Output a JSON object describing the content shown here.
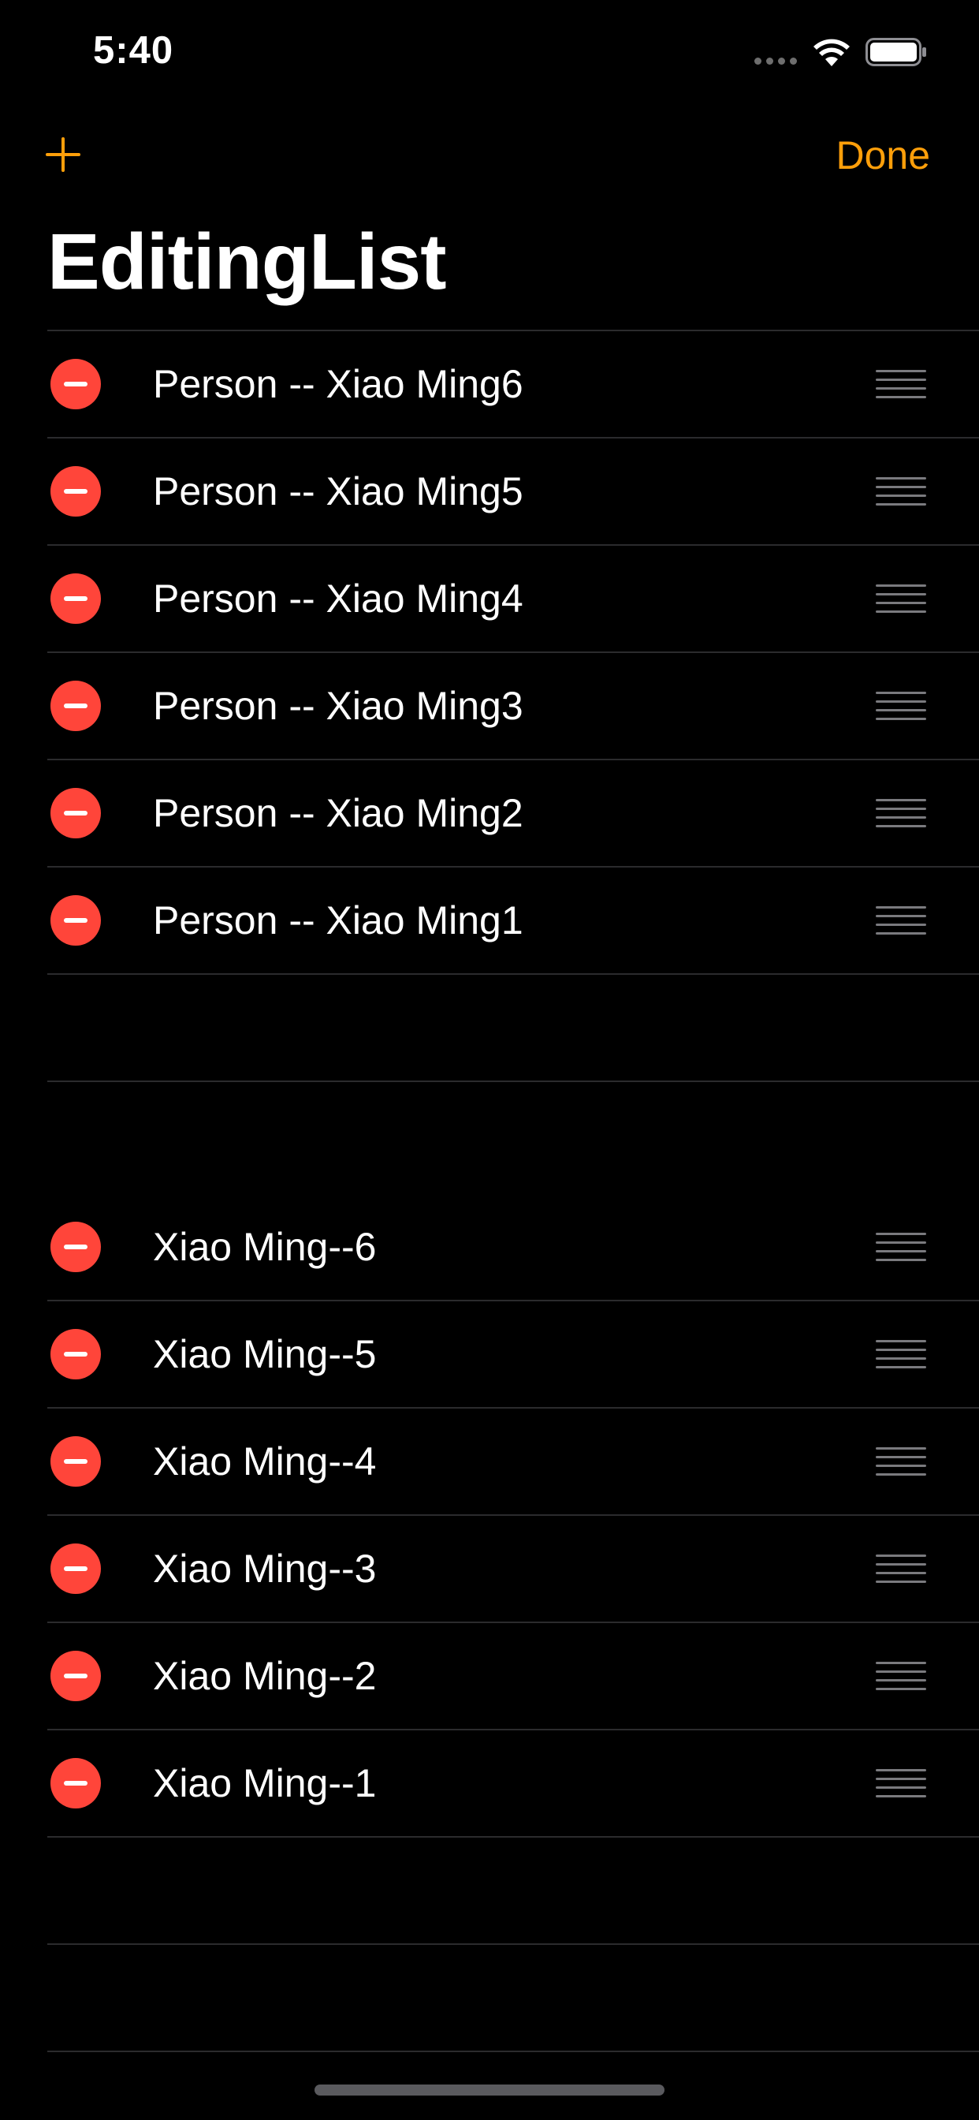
{
  "status_bar": {
    "time": "5:40"
  },
  "nav": {
    "add_icon": "plus-icon",
    "done_label": "Done"
  },
  "title": "EditingList",
  "section_1": {
    "rows": [
      {
        "label": "Person -- Xiao Ming6"
      },
      {
        "label": "Person -- Xiao Ming5"
      },
      {
        "label": "Person -- Xiao Ming4"
      },
      {
        "label": "Person -- Xiao Ming3"
      },
      {
        "label": "Person -- Xiao Ming2"
      },
      {
        "label": "Person -- Xiao Ming1"
      }
    ]
  },
  "section_2": {
    "rows": [
      {
        "label": "Xiao Ming--6"
      },
      {
        "label": "Xiao Ming--5"
      },
      {
        "label": "Xiao Ming--4"
      },
      {
        "label": "Xiao Ming--3"
      },
      {
        "label": "Xiao Ming--2"
      },
      {
        "label": "Xiao Ming--1"
      }
    ]
  },
  "colors": {
    "accent": "#ff9f0a",
    "delete": "#ff453a",
    "background": "#000000"
  }
}
